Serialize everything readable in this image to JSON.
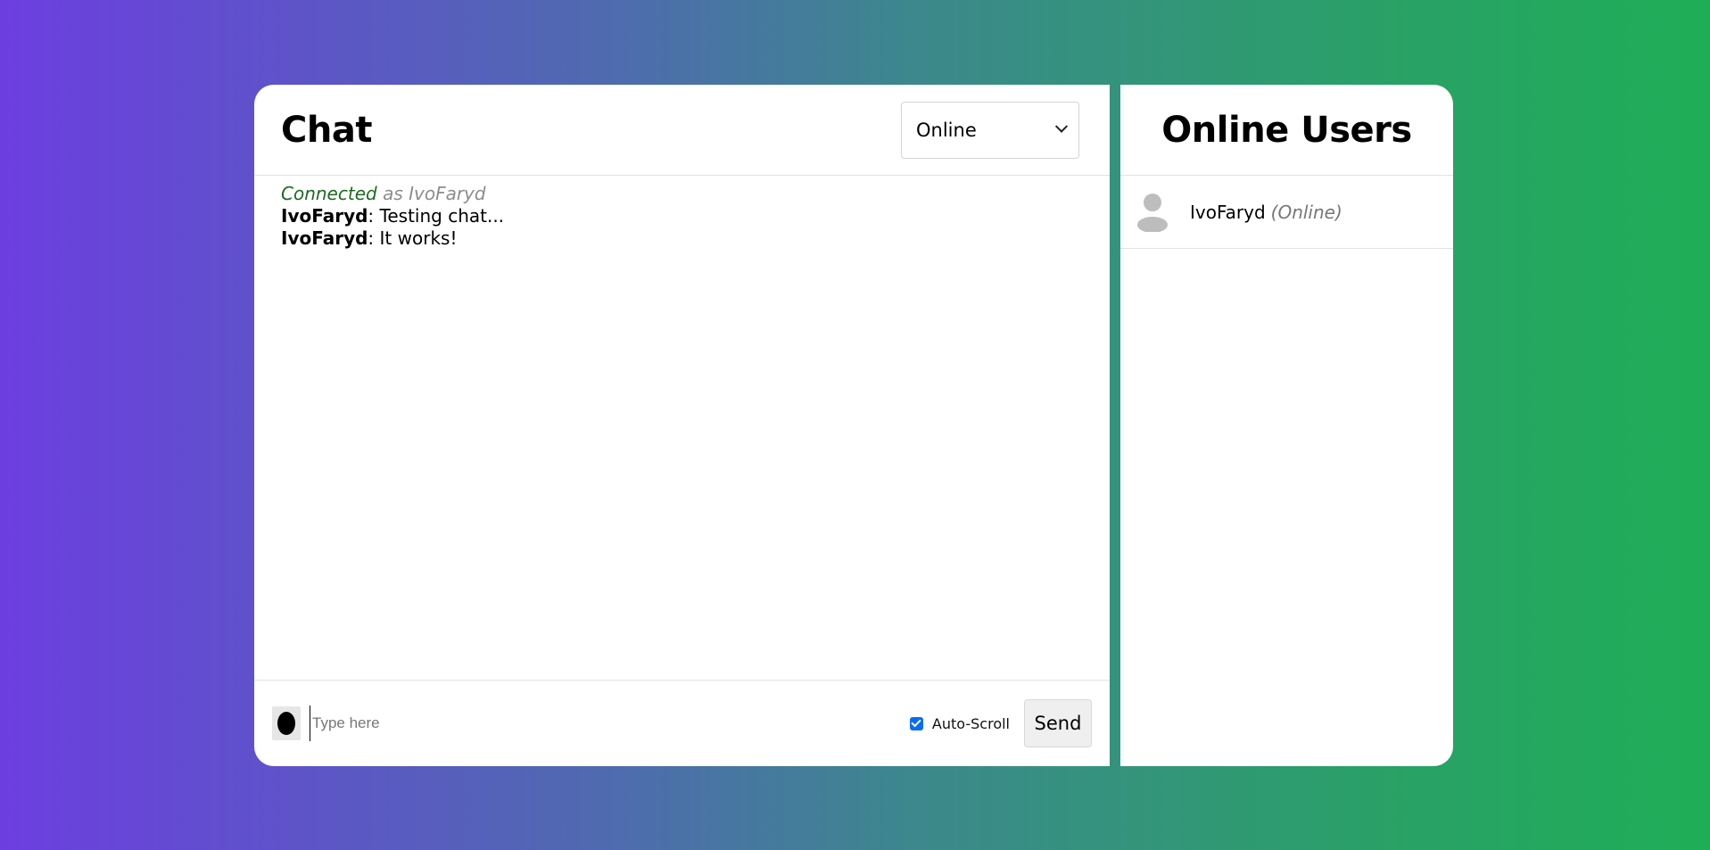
{
  "chat": {
    "title": "Chat",
    "status_select": {
      "selected": "Online",
      "options": [
        "Online"
      ]
    },
    "messages": {
      "system": {
        "connected": "Connected",
        "as_text": "as IvoFaryd"
      },
      "items": [
        {
          "user": "IvoFaryd",
          "separator": ":",
          "text": " Testing chat..."
        },
        {
          "user": "IvoFaryd",
          "separator": ":",
          "text": " It works!"
        }
      ]
    },
    "composer": {
      "placeholder": "Type here",
      "value": "",
      "auto_scroll_label": "Auto-Scroll",
      "auto_scroll_checked": true,
      "send_label": "Send"
    }
  },
  "users": {
    "title": "Online Users",
    "list": [
      {
        "name": "IvoFaryd",
        "status": "(Online)"
      }
    ]
  },
  "colors": {
    "gradient_start": "#6c3ee0",
    "gradient_end": "#1fae57",
    "connected": "#1d6b23",
    "checkbox": "#0a6cf3"
  },
  "icons": {
    "avatar_button": "avatar-icon",
    "user_avatar": "user-silhouette-icon",
    "select_chevron": "chevron-down-icon",
    "checkbox": "checkmark-icon"
  }
}
